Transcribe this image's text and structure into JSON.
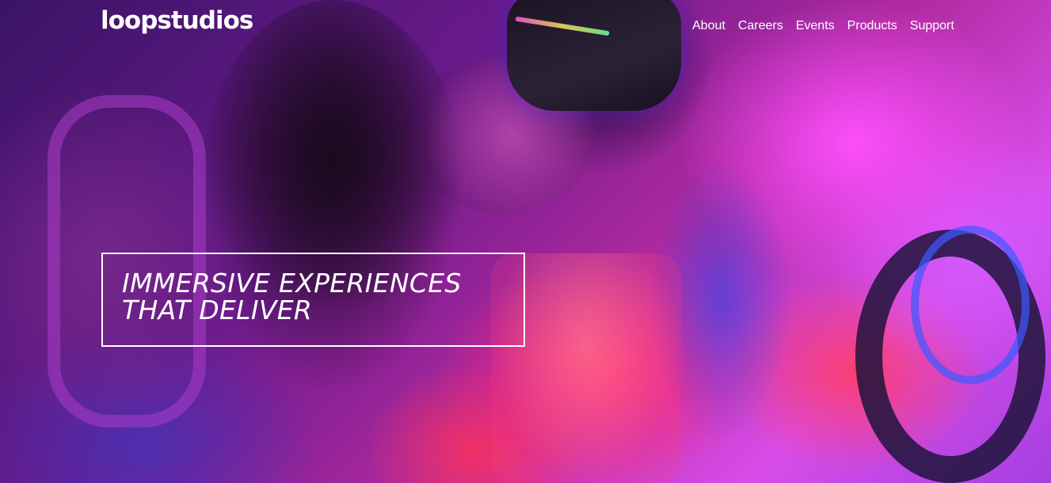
{
  "brand": {
    "logo_text": "loopstudios"
  },
  "nav": {
    "items": [
      {
        "label": "About"
      },
      {
        "label": "Careers"
      },
      {
        "label": "Events"
      },
      {
        "label": "Products"
      },
      {
        "label": "Support"
      }
    ]
  },
  "hero": {
    "headline_line1": "IMMERSIVE EXPERIENCES",
    "headline_line2": "THAT DELIVER"
  },
  "colors": {
    "text": "#ffffff",
    "box_border": "#ffffff"
  }
}
